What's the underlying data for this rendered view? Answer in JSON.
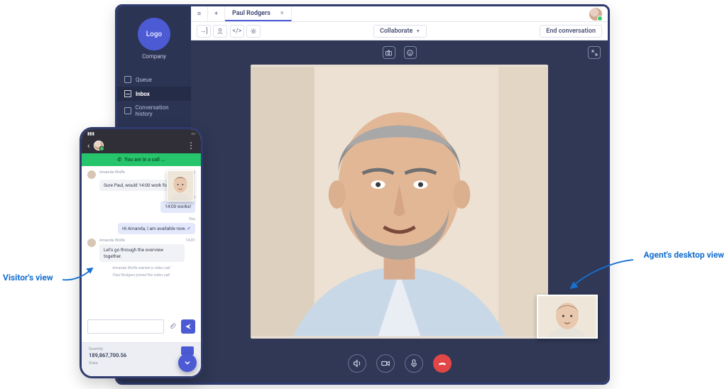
{
  "annotations": {
    "visitor_label": "Visitor's view",
    "agent_label": "Agent's desktop view"
  },
  "desktop": {
    "logo_text": "Logo",
    "company_label": "Company",
    "sidebar": {
      "items": [
        {
          "label": "Queue",
          "active": false
        },
        {
          "label": "Inbox",
          "active": true
        },
        {
          "label": "Conversation history",
          "active": false
        }
      ]
    },
    "tabs": {
      "active_label": "Paul Rodgers"
    },
    "toolbar": {
      "collaborate_label": "Collaborate",
      "end_label": "End conversation"
    }
  },
  "mobile": {
    "call_banner": "You are in a call ...",
    "chat": {
      "msg1_sender": "Amanda Wolfe",
      "msg1_time": "14:00",
      "msg1_text": "Sure Paul, would 14:00 work for you?",
      "msg2_sender": "You",
      "msg2_text": "14:00 works!",
      "msg3_sender": "You",
      "msg3_text": "Hi Amanda, I am available now.",
      "msg4_sender": "Amanda Wolfe",
      "msg4_time": "14:01",
      "msg4_text": "Let's go through the overview together.",
      "sys1": "Amanda Wolfe started a video call",
      "sys2": "Paul Rodgers joined the video call"
    },
    "composer_placeholder": "",
    "summary": {
      "qty_label": "Quantity",
      "qty_value": "189,867,700.56",
      "state_label": "State"
    }
  },
  "colors": {
    "accent": "#4c5bd4",
    "dark": "#2c3454",
    "banner": "#26c56b",
    "hangup": "#e24646",
    "annotation": "#1670d0"
  }
}
